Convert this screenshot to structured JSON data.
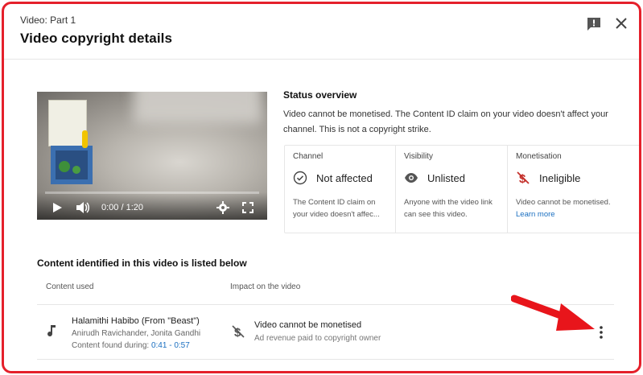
{
  "header": {
    "subtitle": "Video: Part 1",
    "title": "Video copyright details"
  },
  "video_player": {
    "time": "0:00 / 1:20"
  },
  "status_overview": {
    "title": "Status overview",
    "description": "Video cannot be monetised. The Content ID claim on your video doesn't affect your channel. This is not a copyright strike.",
    "columns": [
      {
        "label": "Channel",
        "value": "Not affected",
        "description": "The Content ID claim on your video doesn't affec...",
        "icon": "check-circle-icon"
      },
      {
        "label": "Visibility",
        "value": "Unlisted",
        "description": "Anyone with the video link can see this video.",
        "icon": "eye-icon"
      },
      {
        "label": "Monetisation",
        "value": "Ineligible",
        "description": "Video cannot be monetised.",
        "link": "Learn more",
        "icon": "no-dollar-icon",
        "icon_color": "#c4302b"
      }
    ]
  },
  "content_section": {
    "title": "Content identified in this video is listed below",
    "headers": {
      "content": "Content used",
      "impact": "Impact on the video"
    },
    "rows": [
      {
        "song": "Halamithi Habibo (From \"Beast\")",
        "artists": "Anirudh Ravichander, Jonita Gandhi",
        "found_label": "Content found during:",
        "found_range": "0:41 - 0:57",
        "impact_title": "Video cannot be monetised",
        "impact_sub": "Ad revenue paid to copyright owner"
      }
    ]
  },
  "colors": {
    "frame": "#e5202b",
    "arrow": "#e8151b",
    "link": "#1a6fc0",
    "ineligible": "#c4302b"
  }
}
